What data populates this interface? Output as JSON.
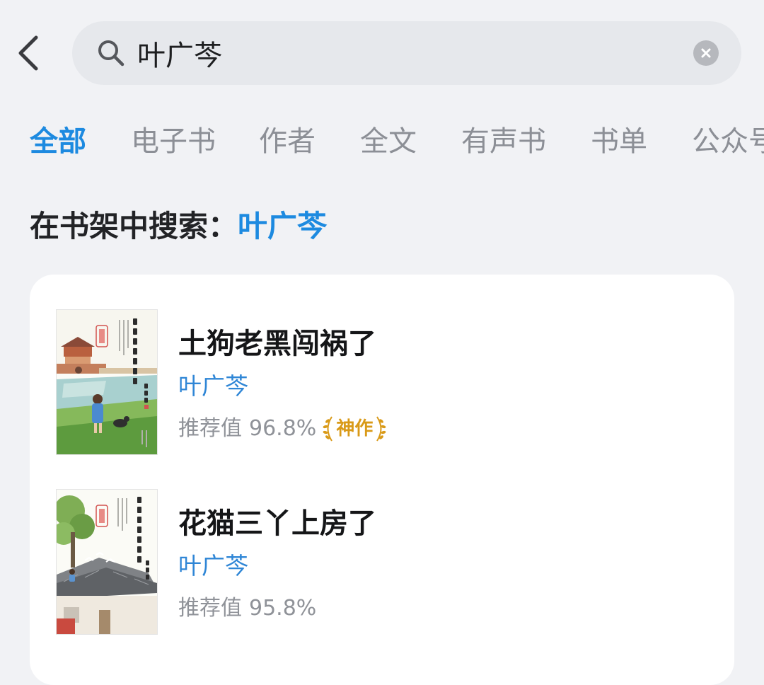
{
  "search": {
    "query": "叶广芩"
  },
  "tabs": [
    {
      "label": "全部",
      "active": true
    },
    {
      "label": "电子书",
      "active": false
    },
    {
      "label": "作者",
      "active": false
    },
    {
      "label": "全文",
      "active": false
    },
    {
      "label": "有声书",
      "active": false
    },
    {
      "label": "书单",
      "active": false
    },
    {
      "label": "公众号",
      "active": false
    }
  ],
  "shelf_search": {
    "label": "在书架中搜索：",
    "keyword": "叶广芩"
  },
  "results": [
    {
      "title": "土狗老黑闯祸了",
      "author": "叶广芩",
      "recommend_label": "推荐值",
      "recommend_value": "96.8%",
      "badge": "神作"
    },
    {
      "title": "花猫三丫上房了",
      "author": "叶广芩",
      "recommend_label": "推荐值",
      "recommend_value": "95.8%"
    }
  ],
  "colors": {
    "accent": "#1d8ae0",
    "author": "#2f86d6",
    "badge_gold": "#d99a18",
    "background": "#f1f2f5",
    "card": "#ffffff"
  },
  "icons": {
    "back": "chevron-left-icon",
    "search": "magnifier-icon",
    "clear": "close-circle-icon",
    "badge": "laurel-icon"
  }
}
